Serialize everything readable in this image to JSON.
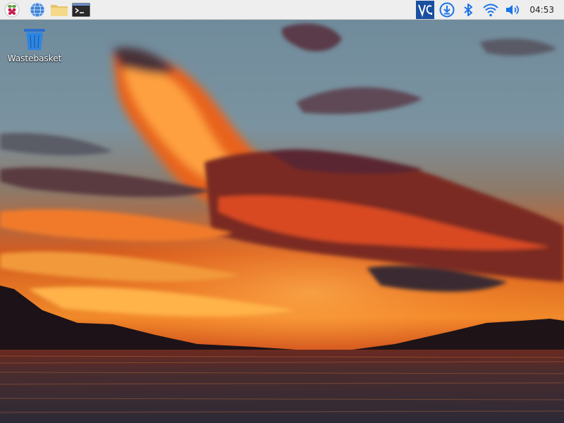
{
  "taskbar": {
    "launchers": [
      {
        "name": "raspberry-menu-icon"
      },
      {
        "name": "globe-icon"
      },
      {
        "name": "folder-icon"
      },
      {
        "name": "terminal-icon"
      }
    ],
    "tray": [
      {
        "name": "vnc-icon"
      },
      {
        "name": "download-update-icon"
      },
      {
        "name": "bluetooth-icon"
      },
      {
        "name": "wifi-icon"
      },
      {
        "name": "volume-icon"
      }
    ],
    "clock": "04:53",
    "accent_color": "#1a73e8",
    "background_color": "#eeeeee"
  },
  "desktop": {
    "icons": [
      {
        "label": "Wastebasket",
        "icon": "wastebasket-icon"
      }
    ]
  }
}
